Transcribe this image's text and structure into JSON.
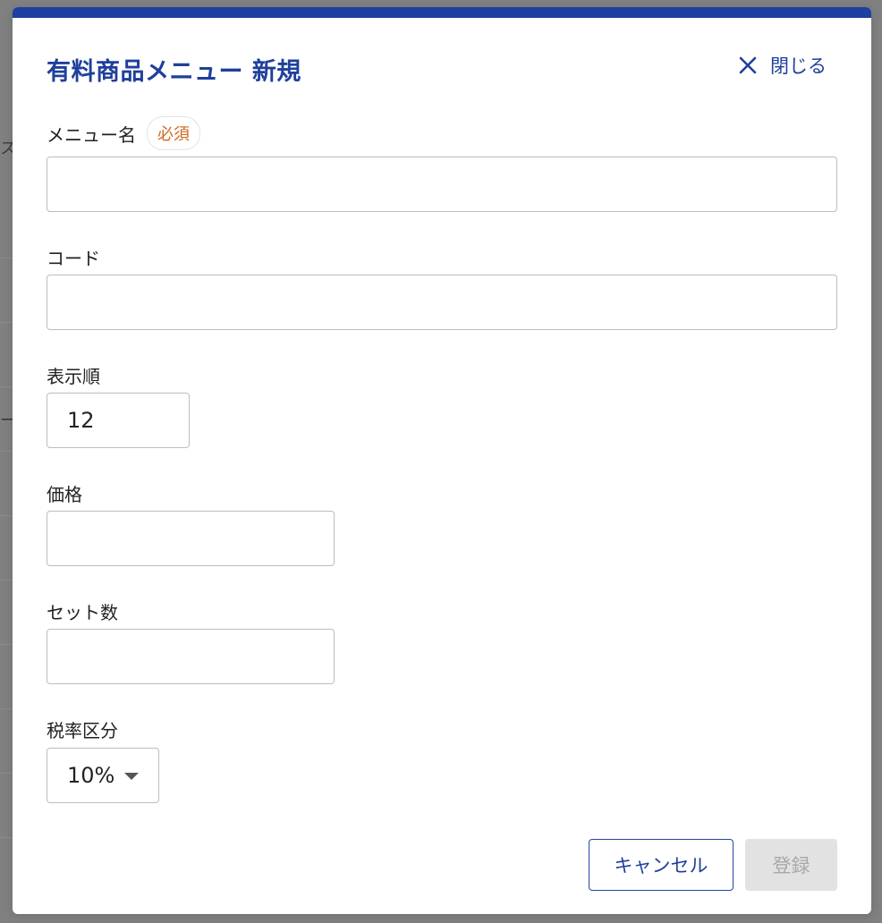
{
  "modal": {
    "title": "有料商品メニュー 新規",
    "close_label": "閉じる",
    "accent_color": "#1e40a0"
  },
  "fields": {
    "menu_name": {
      "label": "メニュー名",
      "required_label": "必須",
      "value": ""
    },
    "code": {
      "label": "コード",
      "value": ""
    },
    "display_order": {
      "label": "表示順",
      "value": "12"
    },
    "price": {
      "label": "価格",
      "value": ""
    },
    "set_count": {
      "label": "セット数",
      "value": ""
    },
    "tax_category": {
      "label": "税率区分",
      "selected": "10%"
    }
  },
  "buttons": {
    "cancel": "キャンセル",
    "submit": "登録"
  },
  "background": {
    "glyph_1": "ス",
    "glyph_2": "ー"
  }
}
